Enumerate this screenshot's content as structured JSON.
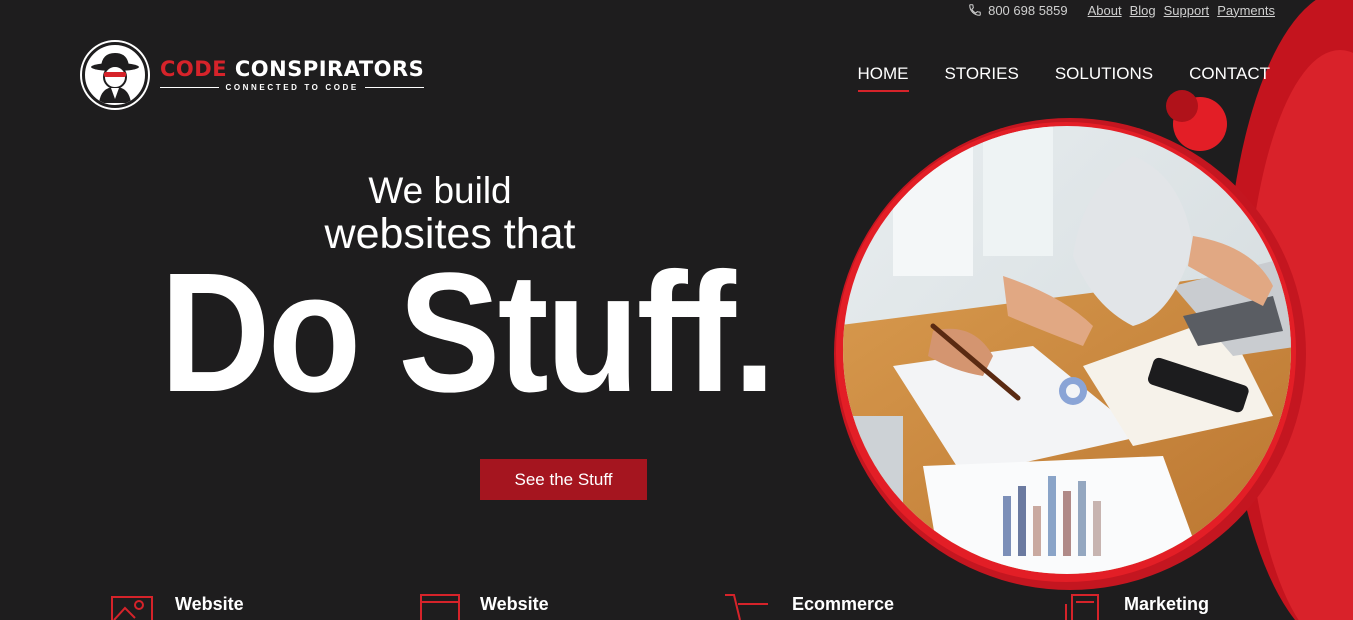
{
  "topbar": {
    "phone": "800 698 5859",
    "links": [
      "About",
      "Blog",
      "Support",
      "Payments"
    ]
  },
  "logo": {
    "word1": "CODE",
    "word2": "CONSPIRATORS",
    "tagline": "CONNECTED TO CODE"
  },
  "nav": {
    "items": [
      "HOME",
      "STORIES",
      "SOLUTIONS",
      "CONTACT"
    ],
    "active": "HOME"
  },
  "hero": {
    "line1": "We build",
    "line2": "websites that",
    "headline": "Do Stuff.",
    "cta": "See the Stuff"
  },
  "services": [
    {
      "label": "Website",
      "icon": "image-icon"
    },
    {
      "label": "Website",
      "icon": "browser-window-icon"
    },
    {
      "label": "Ecommerce",
      "icon": "shopping-cart-icon"
    },
    {
      "label": "Marketing",
      "icon": "document-layers-icon"
    }
  ],
  "colors": {
    "background": "#1e1d1e",
    "accent": "#d6232a",
    "button": "#a5151f"
  }
}
